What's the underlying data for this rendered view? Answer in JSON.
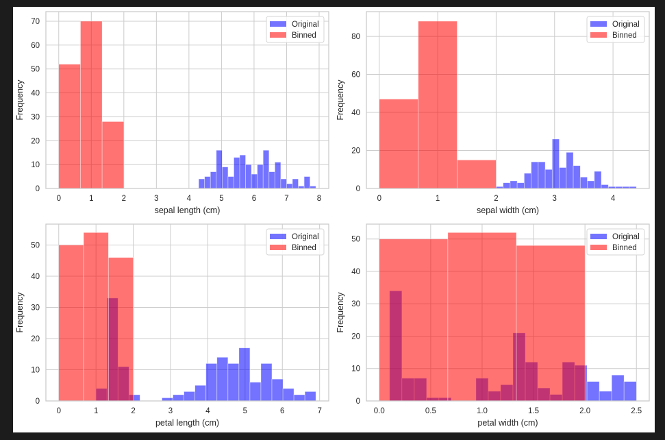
{
  "colors": {
    "original": "#0000ff",
    "binned": "#ff0000",
    "grid": "#cccccc",
    "frame": "#cccccc",
    "background": "#ffffff",
    "page": "#1c1c1c"
  },
  "legend": {
    "entries": [
      "Original",
      "Binned"
    ],
    "placement": "upper right"
  },
  "chart_data": [
    {
      "type": "bar",
      "title": "",
      "xlabel": "sepal length (cm)",
      "ylabel": "Frequency",
      "xlim": [
        -0.395,
        8.295
      ],
      "ylim": [
        0,
        74
      ],
      "xticks": [
        0,
        1,
        2,
        3,
        4,
        5,
        6,
        7,
        8
      ],
      "xtick_labels": [
        "0",
        "1",
        "2",
        "3",
        "4",
        "5",
        "6",
        "7",
        "8"
      ],
      "yticks": [
        0,
        10,
        20,
        30,
        40,
        50,
        60,
        70
      ],
      "ytick_labels": [
        "0",
        "10",
        "20",
        "30",
        "40",
        "50",
        "60",
        "70"
      ],
      "grid": true,
      "legend": [
        "Original",
        "Binned"
      ],
      "series": [
        {
          "name": "Original",
          "bin_start": 4.3,
          "bin_end": 7.9,
          "values": [
            4,
            5,
            7,
            16,
            9,
            5,
            13,
            14,
            10,
            6,
            10,
            16,
            7,
            11,
            4,
            2,
            4,
            1,
            5,
            1
          ]
        },
        {
          "name": "Binned",
          "bin_start": 0,
          "bin_end": 2,
          "values": [
            52,
            70,
            28
          ]
        }
      ]
    },
    {
      "type": "bar",
      "title": "",
      "xlabel": "sepal width (cm)",
      "ylabel": "Frequency",
      "xlim": [
        -0.22,
        4.62
      ],
      "ylim": [
        0,
        93
      ],
      "xticks": [
        0,
        1,
        2,
        3,
        4
      ],
      "xtick_labels": [
        "0",
        "1",
        "2",
        "3",
        "4"
      ],
      "yticks": [
        0,
        20,
        40,
        60,
        80
      ],
      "ytick_labels": [
        "0",
        "20",
        "40",
        "60",
        "80"
      ],
      "grid": true,
      "legend": [
        "Original",
        "Binned"
      ],
      "series": [
        {
          "name": "Original",
          "bin_start": 2.0,
          "bin_end": 4.4,
          "values": [
            1,
            3,
            4,
            3,
            8,
            14,
            14,
            10,
            26,
            11,
            19,
            12,
            6,
            4,
            9,
            2,
            1,
            1,
            1,
            1
          ]
        },
        {
          "name": "Binned",
          "bin_start": 0,
          "bin_end": 2,
          "values": [
            47,
            88,
            15
          ]
        }
      ]
    },
    {
      "type": "bar",
      "title": "",
      "xlabel": "petal length (cm)",
      "ylabel": "Frequency",
      "xlim": [
        -0.345,
        7.245
      ],
      "ylim": [
        0,
        56.7
      ],
      "xticks": [
        0,
        1,
        2,
        3,
        4,
        5,
        6,
        7
      ],
      "xtick_labels": [
        "0",
        "1",
        "2",
        "3",
        "4",
        "5",
        "6",
        "7"
      ],
      "yticks": [
        0,
        10,
        20,
        30,
        40,
        50
      ],
      "ytick_labels": [
        "0",
        "10",
        "20",
        "30",
        "40",
        "50"
      ],
      "grid": true,
      "legend": [
        "Original",
        "Binned"
      ],
      "series": [
        {
          "name": "Original",
          "bin_start": 1.0,
          "bin_end": 6.9,
          "values": [
            4,
            33,
            11,
            2,
            0,
            0,
            1,
            2,
            3,
            5,
            12,
            14,
            12,
            17,
            6,
            12,
            7,
            4,
            2,
            3
          ]
        },
        {
          "name": "Binned",
          "bin_start": 0,
          "bin_end": 2,
          "values": [
            50,
            54,
            46
          ]
        }
      ]
    },
    {
      "type": "bar",
      "title": "",
      "xlabel": "petal width (cm)",
      "ylabel": "Frequency",
      "xlim": [
        -0.125,
        2.625
      ],
      "ylim": [
        0,
        54.6
      ],
      "xticks": [
        0,
        0.5,
        1.0,
        1.5,
        2.0,
        2.5
      ],
      "xtick_labels": [
        "0.0",
        "0.5",
        "1.0",
        "1.5",
        "2.0",
        "2.5"
      ],
      "yticks": [
        0,
        10,
        20,
        30,
        40,
        50
      ],
      "ytick_labels": [
        "0",
        "10",
        "20",
        "30",
        "40",
        "50"
      ],
      "grid": true,
      "legend": [
        "Original",
        "Binned"
      ],
      "series": [
        {
          "name": "Original",
          "bin_start": 0.1,
          "bin_end": 2.5,
          "values": [
            34,
            7,
            7,
            1,
            1,
            0,
            0,
            7,
            3,
            5,
            21,
            12,
            4,
            2,
            12,
            11,
            6,
            3,
            8,
            6
          ]
        },
        {
          "name": "Binned",
          "bin_start": 0,
          "bin_end": 2,
          "values": [
            50,
            52,
            48
          ]
        }
      ]
    }
  ]
}
